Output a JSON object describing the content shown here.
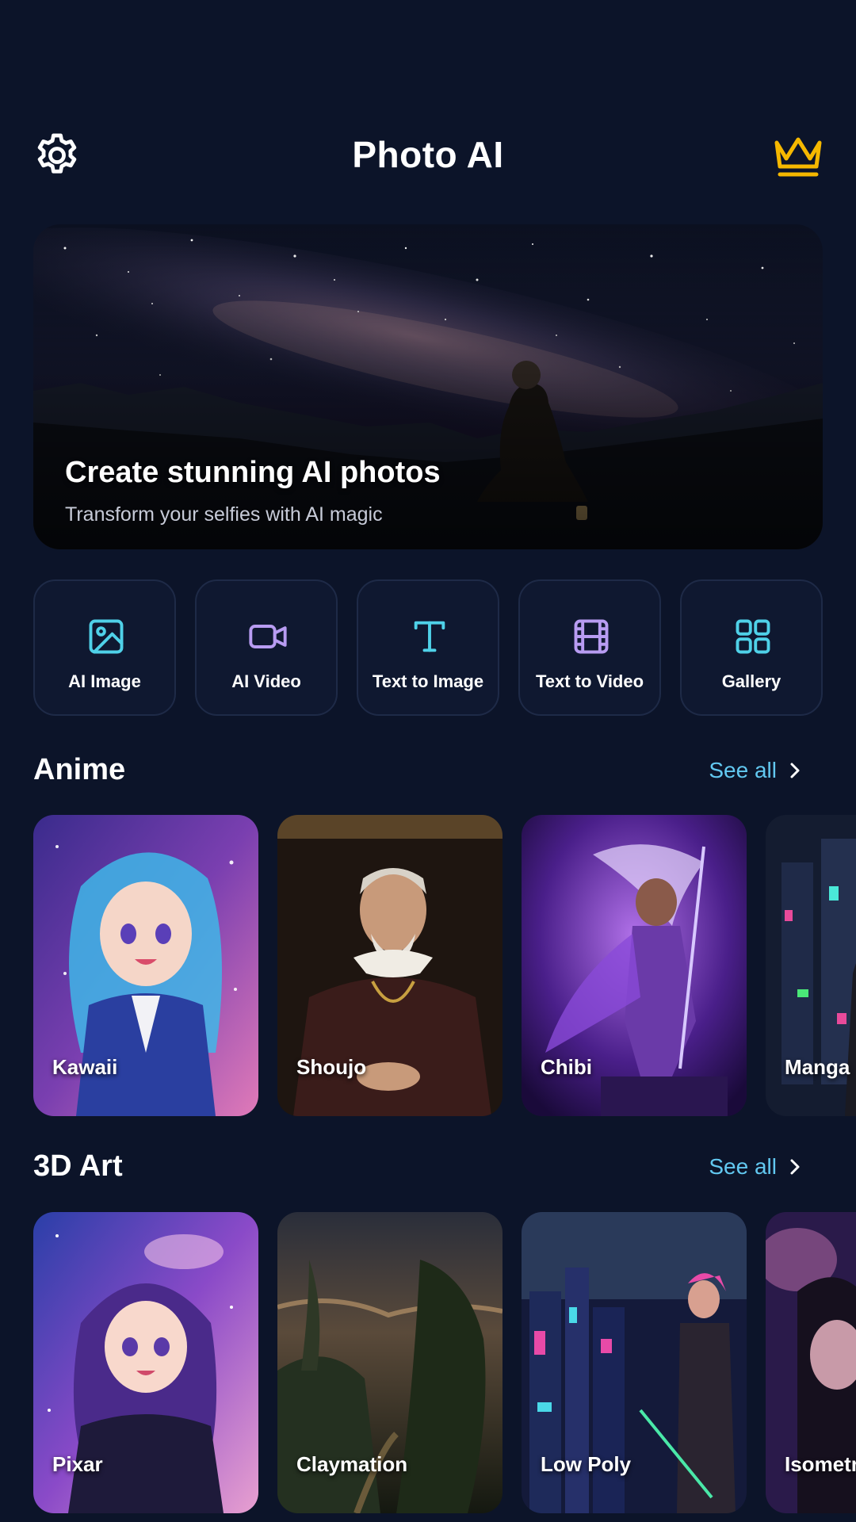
{
  "header": {
    "title": "Photo AI",
    "settings_icon": "gear-icon",
    "premium_icon": "crown-icon",
    "premium_color": "#f5b800"
  },
  "hero": {
    "title": "Create stunning AI photos",
    "subtitle": "Transform your selfies with AI magic"
  },
  "quick_actions": [
    {
      "label": "AI Image",
      "icon": "image-icon",
      "color": "#4fd1e8"
    },
    {
      "label": "AI Video",
      "icon": "video-camera-icon",
      "color": "#b89cf2"
    },
    {
      "label": "Text to Image",
      "icon": "text-icon",
      "color": "#4fd1e8"
    },
    {
      "label": "Text to Video",
      "icon": "film-icon",
      "color": "#b89cf2"
    },
    {
      "label": "Gallery",
      "icon": "grid-icon",
      "color": "#4fd1e8"
    }
  ],
  "sections": [
    {
      "title": "Anime",
      "see_all": "See all",
      "cards": [
        {
          "label": "Kawaii"
        },
        {
          "label": "Shoujo"
        },
        {
          "label": "Chibi"
        },
        {
          "label": "Manga"
        }
      ]
    },
    {
      "title": "3D Art",
      "see_all": "See all",
      "cards": [
        {
          "label": "Pixar"
        },
        {
          "label": "Claymation"
        },
        {
          "label": "Low Poly"
        },
        {
          "label": "Isometric"
        }
      ]
    }
  ],
  "colors": {
    "background": "#0c1429",
    "accent_link": "#62c8f0"
  }
}
